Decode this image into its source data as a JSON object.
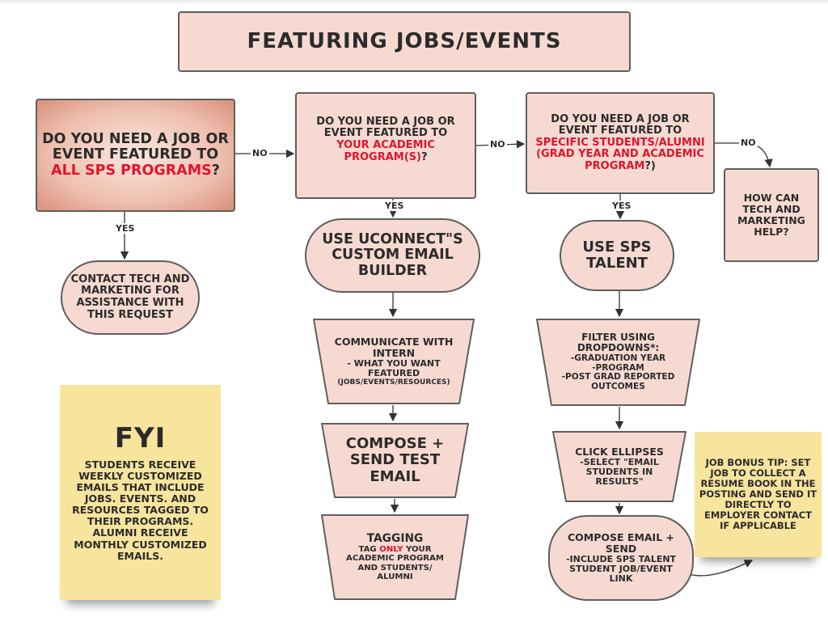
{
  "title": "FEATURING JOBS/EVENTS",
  "colors": {
    "node_fill": "#f6dad2",
    "highlight": "#e0142b",
    "note_fill": "#f7e49d",
    "stroke": "#5e5e5e"
  },
  "questions": {
    "q1": {
      "pre": "DO YOU NEED A JOB OR EVENT FEATURED TO ",
      "red": "ALL SPS PROGRAMS",
      "post": "?"
    },
    "q2": {
      "pre": "DO YOU NEED A JOB OR EVENT FEATURED TO ",
      "red": "YOUR ACADEMIC PROGRAM(S)",
      "post": "?"
    },
    "q3": {
      "pre": "DO YOU NEED A JOB OR EVENT FEATURED TO ",
      "red": "SPECIFIC STUDENTS/ALUMNI (GRAD YEAR AND ACADEMIC PROGRAM",
      "post": "?)"
    },
    "q4": "HOW CAN TECH AND MARKETING HELP?"
  },
  "labels": {
    "yes": "YES",
    "no": "NO"
  },
  "branch_all": {
    "action": "CONTACT TECH AND MARKETING FOR ASSISTANCE WITH THIS REQUEST"
  },
  "branch_program": {
    "start": "USE UCONNECT\"S CUSTOM EMAIL BUILDER",
    "step1_title": "COMMUNICATE WITH INTERN",
    "step1_sub": "- WHAT YOU WANT FEATURED",
    "step1_small": "(JOBS/EVENTS/RESOURCES)",
    "step2": "COMPOSE + SEND TEST EMAIL",
    "step3_title": "TAGGING",
    "step3_pre": "TAG ",
    "step3_red": "ONLY",
    "step3_post": " YOUR ACADEMIC PROGRAM AND STUDENTS/ ALUMNI"
  },
  "branch_specific": {
    "start": "USE SPS TALENT",
    "step1_title": "FILTER USING DROPDOWNS*:",
    "step1_items": [
      "-GRADUATION YEAR",
      "-PROGRAM",
      "-POST GRAD REPORTED OUTCOMES"
    ],
    "step2_title": "CLICK ELLIPSES",
    "step2_sub": "-SELECT \"EMAIL STUDENTS IN RESULTS\"",
    "step3_title": "COMPOSE EMAIL + SEND",
    "step3_sub": "-INCLUDE SPS TALENT STUDENT JOB/EVENT LINK"
  },
  "fyi": {
    "heading": "FYI",
    "body": "STUDENTS RECEIVE WEEKLY CUSTOMIZED EMAILS THAT INCLUDE JOBS. EVENTS. AND RESOURCES TAGGED TO THEIR PROGRAMS. ALUMNI RECEIVE MONTHLY CUSTOMIZED EMAILS."
  },
  "tip": "JOB BONUS TIP: SET JOB TO COLLECT A RESUME BOOK IN THE POSTING AND SEND IT DIRECTLY TO EMPLOYER CONTACT IF APPLICABLE"
}
